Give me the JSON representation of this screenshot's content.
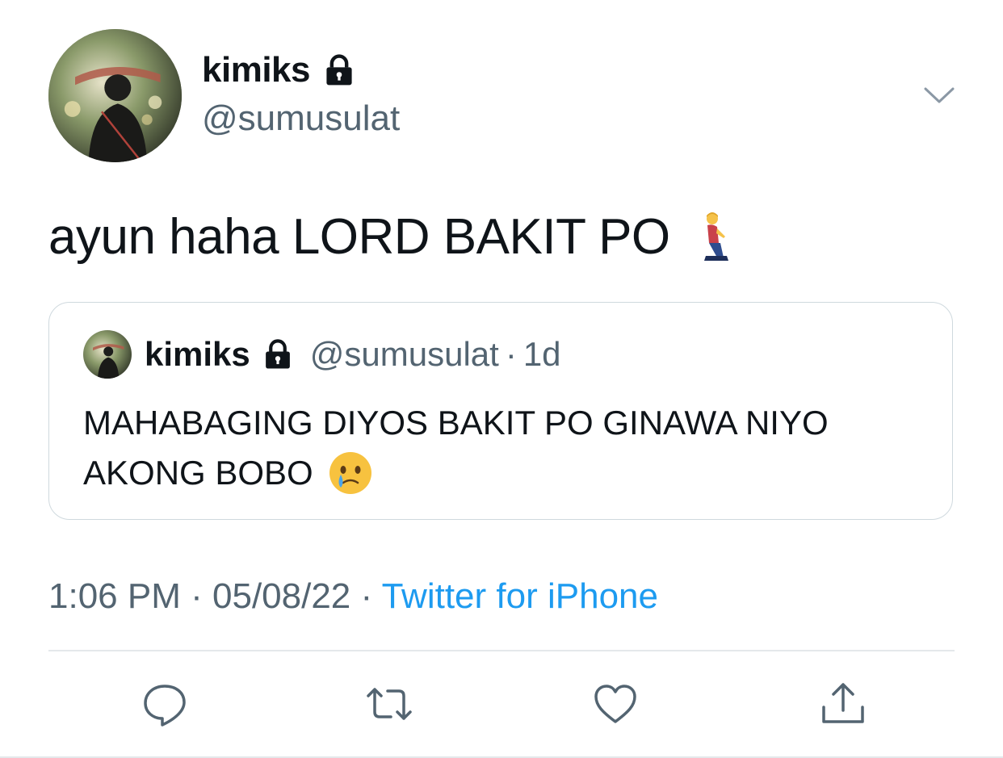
{
  "tweet": {
    "author": {
      "display_name": "kimiks",
      "handle": "@sumusulat",
      "protected": true
    },
    "text": "ayun haha LORD BAKIT PO",
    "text_emoji": "person-kneeling",
    "timestamp_time": "1:06 PM",
    "timestamp_date": "05/08/22",
    "separator": "·",
    "source": "Twitter for iPhone"
  },
  "quoted_tweet": {
    "display_name": "kimiks",
    "handle": "@sumusulat",
    "separator": "·",
    "age": "1d",
    "text": "MAHABAGING DIYOS BAKIT PO GINAWA NIYO AKONG BOBO",
    "text_emoji": "face-holding-back-tears"
  },
  "actions": [
    {
      "name": "reply",
      "icon": "reply-icon"
    },
    {
      "name": "retweet",
      "icon": "retweet-icon"
    },
    {
      "name": "like",
      "icon": "heart-icon"
    },
    {
      "name": "share",
      "icon": "share-icon"
    }
  ],
  "colors": {
    "text_primary": "#0f1419",
    "text_secondary": "#536471",
    "link": "#1d9bf0",
    "border": "#cfd9de",
    "icon": "#536471"
  }
}
